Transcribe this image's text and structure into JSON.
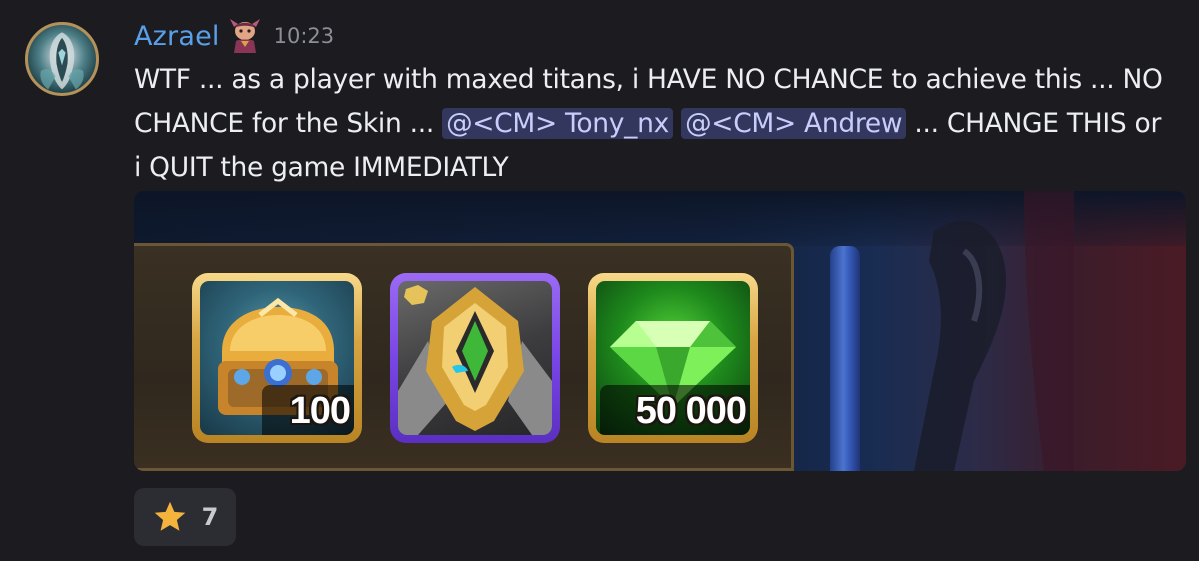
{
  "author": {
    "username": "Azrael",
    "timestamp": "10:23",
    "avatar_icon": "hooded-figure-avatar",
    "role_icon": "character-role-icon"
  },
  "message": {
    "part1": "WTF ... as a player with maxed titans, i HAVE NO CHANCE to achieve this ... NO CHANCE for the Skin ... ",
    "mention1": "@<CM> Tony_nx",
    "mention2": "@<CM> Andrew",
    "part2": " ... CHANGE THIS or i QUIT the game IMMEDIATLY"
  },
  "embed": {
    "items": [
      {
        "name": "chest",
        "icon": "golden-chest-icon",
        "count": "100",
        "frame": "gold"
      },
      {
        "name": "titan-skin",
        "icon": "armored-titan-icon",
        "count": "",
        "frame": "purple"
      },
      {
        "name": "emeralds",
        "icon": "green-emerald-icon",
        "count": "50 000",
        "frame": "gold"
      }
    ]
  },
  "reaction": {
    "emoji": "star-icon",
    "count": "7"
  },
  "colors": {
    "background": "#1b1b20",
    "username": "#5aa0e8",
    "mention_bg": "#33375e",
    "mention_text": "#c9cdfb",
    "gold_frame": "#d7a443",
    "purple_frame": "#7a45e6",
    "star": "#f3b33d"
  }
}
